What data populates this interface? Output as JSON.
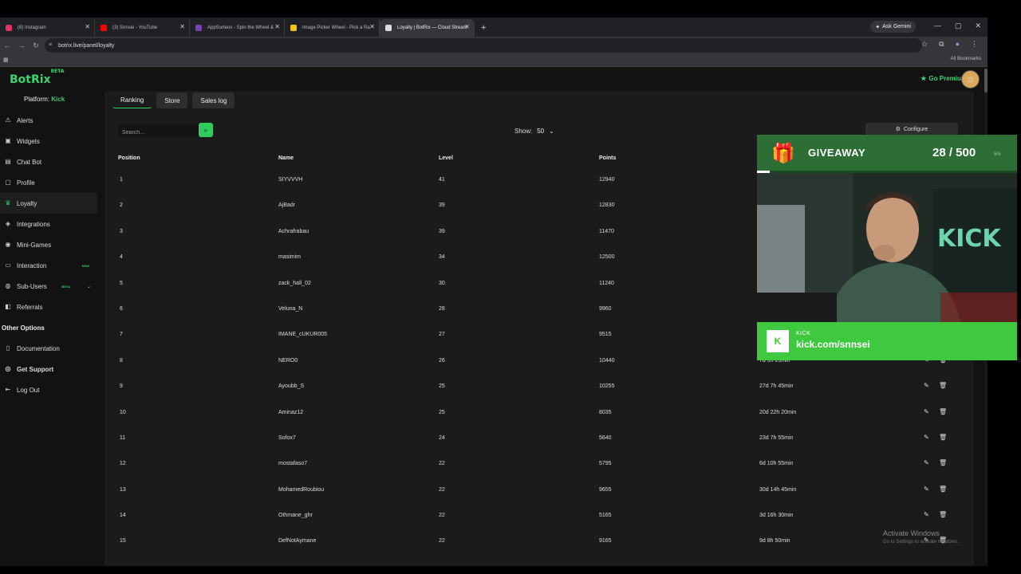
{
  "browser": {
    "tabs": [
      {
        "label": "(8) Instagram",
        "favicon_color": "#e1306c",
        "active": false
      },
      {
        "label": "(3) Snnsei - YouTube",
        "favicon_color": "#ff0000",
        "active": false
      },
      {
        "label": "AppSorteos - Spin the Wheel &",
        "favicon_color": "#7b3fb5",
        "active": false
      },
      {
        "label": "Image Picker Wheel - Pick a Ra",
        "favicon_color": "#f5c518",
        "active": false
      },
      {
        "label": "Loyalty | BotRix — Cloud Stream",
        "favicon_color": "#dddddd",
        "active": true
      }
    ],
    "new_tab": "+",
    "ask_gemini": "Ask Gemini",
    "url": "botrix.live/panel/loyalty",
    "all_bookmarks": "All Bookmarks"
  },
  "app": {
    "logo": "BotRix",
    "logo_badge": "BETA",
    "platform_label": "Platform:",
    "platform_value": "Kick",
    "go_premium": "Go Premium"
  },
  "sidebar": {
    "items": [
      {
        "label": "Alerts",
        "icon": "warning-icon",
        "glyph": "⚠"
      },
      {
        "label": "Widgets",
        "icon": "widgets-icon",
        "glyph": "▣"
      },
      {
        "label": "Chat Bot",
        "icon": "chat-icon",
        "glyph": "▤"
      },
      {
        "label": "Profile",
        "icon": "profile-icon",
        "glyph": "▢"
      },
      {
        "label": "Loyalty",
        "icon": "loyalty-icon",
        "glyph": "♛"
      },
      {
        "label": "Integrations",
        "icon": "integrations-icon",
        "glyph": "◈"
      },
      {
        "label": "Mini-Games",
        "icon": "gamepad-icon",
        "glyph": "◉"
      },
      {
        "label": "Interaction",
        "icon": "interaction-icon",
        "glyph": "▭",
        "badge": "NEW"
      },
      {
        "label": "Sub-Users",
        "icon": "users-icon",
        "glyph": "◍",
        "badge": "BETA"
      },
      {
        "label": "Referrals",
        "icon": "referrals-icon",
        "glyph": "◧"
      }
    ],
    "other_heading": "Other Options",
    "other_items": [
      {
        "label": "Documentation",
        "icon": "document-icon",
        "glyph": "▯"
      },
      {
        "label": "Get Support",
        "icon": "support-icon",
        "glyph": "◎"
      },
      {
        "label": "Log Out",
        "icon": "logout-icon",
        "glyph": "⇤"
      }
    ]
  },
  "page": {
    "tabs": [
      "Ranking",
      "Store",
      "Sales log"
    ],
    "search_placeholder": "Search...",
    "show_label": "Show:",
    "show_value": "50",
    "configure_label": "Configure",
    "columns": [
      "Position",
      "Name",
      "Level",
      "Points"
    ],
    "rows": [
      {
        "pos": "1",
        "name": "SIYVVVH",
        "level": "41",
        "points": "12940",
        "time": ""
      },
      {
        "pos": "2",
        "name": "AjBadr",
        "level": "39",
        "points": "12830",
        "time": ""
      },
      {
        "pos": "3",
        "name": "Achrafrabau",
        "level": "39",
        "points": "11470",
        "time": ""
      },
      {
        "pos": "4",
        "name": "masimim",
        "level": "34",
        "points": "12500",
        "time": ""
      },
      {
        "pos": "5",
        "name": "zack_hall_02",
        "level": "30",
        "points": "11240",
        "time": ""
      },
      {
        "pos": "6",
        "name": "Veluna_N",
        "level": "28",
        "points": "9960",
        "time": ""
      },
      {
        "pos": "7",
        "name": "IMANE_cUKUR005",
        "level": "27",
        "points": "9515",
        "time": ""
      },
      {
        "pos": "8",
        "name": "NERO0",
        "level": "26",
        "points": "10440",
        "time": "7d 9h 25min"
      },
      {
        "pos": "9",
        "name": "Ayoubb_S",
        "level": "25",
        "points": "10255",
        "time": "27d 7h 45min"
      },
      {
        "pos": "10",
        "name": "Aminaz12",
        "level": "25",
        "points": "8035",
        "time": "20d 22h 20min"
      },
      {
        "pos": "11",
        "name": "Sofox7",
        "level": "24",
        "points": "5640",
        "time": "23d 7h 55min"
      },
      {
        "pos": "12",
        "name": "mostafaso7",
        "level": "22",
        "points": "5795",
        "time": "6d 10h 55min"
      },
      {
        "pos": "13",
        "name": "MohamedRoubiou",
        "level": "22",
        "points": "9655",
        "time": "30d 14h 45min"
      },
      {
        "pos": "14",
        "name": "Othmane_ghr",
        "level": "22",
        "points": "5165",
        "time": "3d 16h 30min"
      },
      {
        "pos": "15",
        "name": "DefNotAymane",
        "level": "22",
        "points": "9165",
        "time": "9d 8h 50min"
      }
    ]
  },
  "overlay": {
    "giveaway_title": "GIVEAWAY",
    "giveaway_count": "28 / 500",
    "giveaway_percent": "5%",
    "giveaway_progress": 0.05,
    "kick_label": "KICK",
    "kick_url": "kick.com/snnsei"
  },
  "watermark": {
    "line1": "Activate Windows",
    "line2": "Go to Settings to activate Windows."
  },
  "colors": {
    "accent_green": "#2fd265",
    "overlay_green": "#3ec93e"
  }
}
